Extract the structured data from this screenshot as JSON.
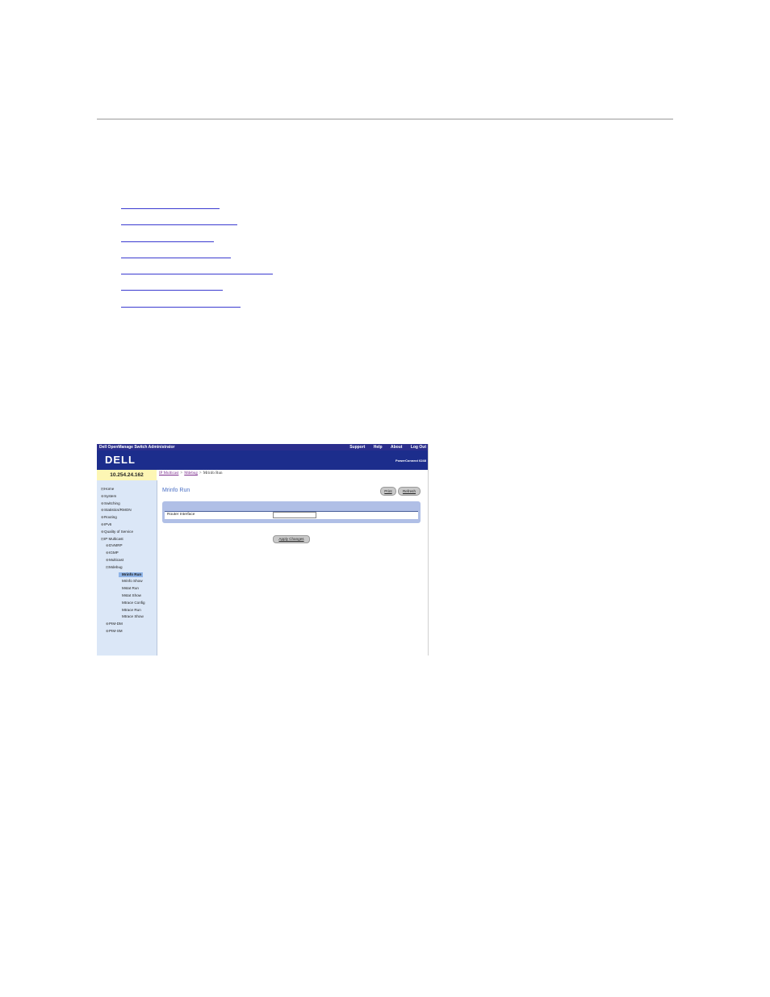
{
  "document": {
    "link_count": 7
  },
  "screenshot": {
    "app_title": "Dell OpenManage Switch Administrator",
    "top_links": [
      "Support",
      "Help",
      "About",
      "Log Out"
    ],
    "logo": "DELL",
    "product": "PowerConnect 6248",
    "ip_address": "10.254.24.162",
    "breadcrumb": {
      "items": [
        "IP Multicast",
        "Mdebug"
      ],
      "current": "Mrinfo Run",
      "separator": ">"
    },
    "nav": {
      "items": [
        {
          "label": "Home",
          "expander": "⊟",
          "level": 0
        },
        {
          "label": "System",
          "expander": "⊕",
          "level": 0
        },
        {
          "label": "Switching",
          "expander": "⊕",
          "level": 0
        },
        {
          "label": "Statistics/RMON",
          "expander": "⊕",
          "level": 0
        },
        {
          "label": "Routing",
          "expander": "⊕",
          "level": 0
        },
        {
          "label": "IPv6",
          "expander": "⊕",
          "level": 0
        },
        {
          "label": "Quality of Service",
          "expander": "⊕",
          "level": 0
        },
        {
          "label": "IP Multicast",
          "expander": "⊟",
          "level": 0
        },
        {
          "label": "DVMRP",
          "expander": "⊕",
          "level": 1
        },
        {
          "label": "IGMP",
          "expander": "⊕",
          "level": 1
        },
        {
          "label": "Multicast",
          "expander": "⊕",
          "level": 1
        },
        {
          "label": "Mdebug",
          "expander": "⊟",
          "level": 1
        },
        {
          "label": "Mrinfo Run",
          "expander": "",
          "level": 2,
          "active": true
        },
        {
          "label": "Mrinfo Show",
          "expander": "",
          "level": 2
        },
        {
          "label": "Mstat Run",
          "expander": "",
          "level": 2
        },
        {
          "label": "Mstat Show",
          "expander": "",
          "level": 2
        },
        {
          "label": "Mtrace Config",
          "expander": "",
          "level": 2
        },
        {
          "label": "Mtrace Run",
          "expander": "",
          "level": 2
        },
        {
          "label": "Mtrace Show",
          "expander": "",
          "level": 2
        },
        {
          "label": "PIM-DM",
          "expander": "⊕",
          "level": 1
        },
        {
          "label": "PIM-SM",
          "expander": "⊕",
          "level": 1
        }
      ]
    },
    "content": {
      "title": "Mrinfo Run",
      "print_label": "Print",
      "refresh_label": "Refresh",
      "field_label": "Router Interface",
      "field_value": "",
      "apply_label": "Apply Changes"
    },
    "colors": {
      "banner": "#1c2d8c",
      "titlebar": "#2b2e8c",
      "nav_bg": "#dbe7f7",
      "ip_bg": "#fdf6b4",
      "panel": "#b0bfe6",
      "link": "#3b3bd0"
    }
  }
}
